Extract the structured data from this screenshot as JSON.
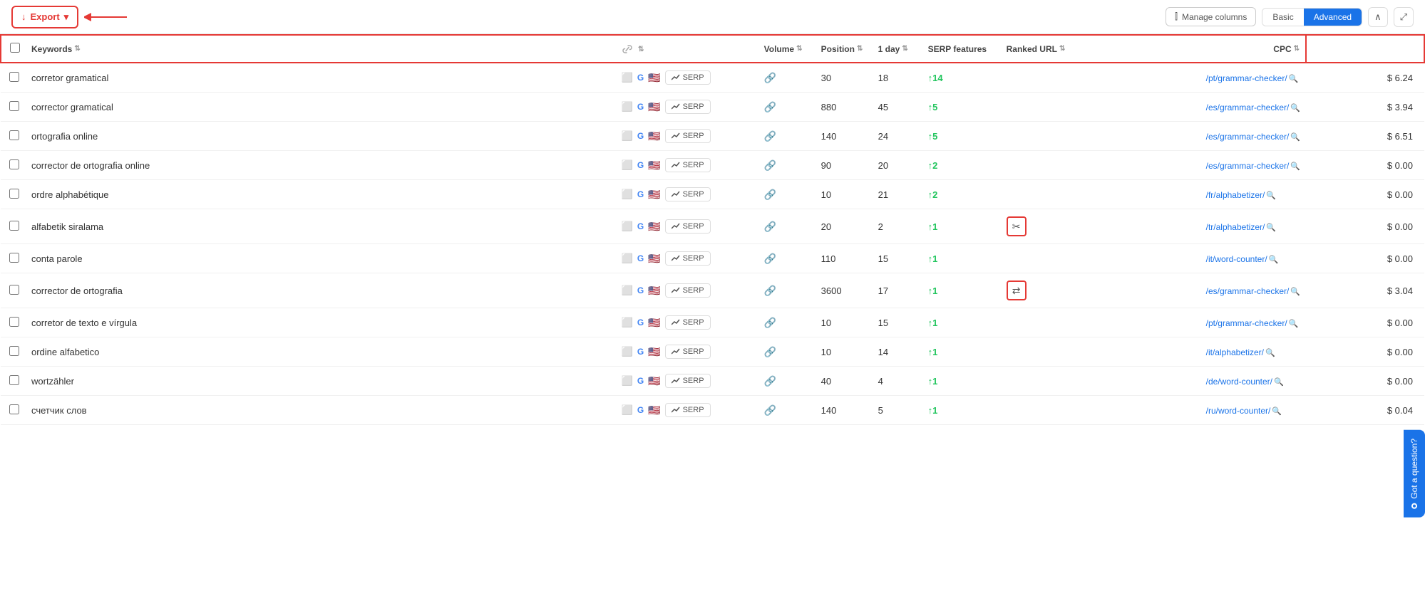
{
  "toolbar": {
    "export_label": "Export",
    "manage_columns_label": "Manage columns",
    "basic_label": "Basic",
    "advanced_label": "Advanced",
    "collapse_icon": "chevron-up",
    "expand_icon": "expand"
  },
  "table": {
    "columns": {
      "checkbox": "",
      "keywords": "Keywords",
      "volume": "Volume",
      "position": "Position",
      "one_day": "1 day",
      "serp_features": "SERP features",
      "ranked_url": "Ranked URL",
      "cpc": "CPC"
    },
    "rows": [
      {
        "keyword": "corretor gramatical",
        "volume": "30",
        "position": "18",
        "change": "+14",
        "change_dir": "up",
        "url": "/pt/grammar-checker/",
        "cpc": "$ 6.24",
        "serp_icon": ""
      },
      {
        "keyword": "corrector gramatical",
        "volume": "880",
        "position": "45",
        "change": "+5",
        "change_dir": "up",
        "url": "/es/grammar-checker/",
        "cpc": "$ 3.94",
        "serp_icon": ""
      },
      {
        "keyword": "ortografia online",
        "volume": "140",
        "position": "24",
        "change": "+5",
        "change_dir": "up",
        "url": "/es/grammar-checker/",
        "cpc": "$ 6.51",
        "serp_icon": ""
      },
      {
        "keyword": "corrector de ortografia online",
        "volume": "90",
        "position": "20",
        "change": "+2",
        "change_dir": "up",
        "url": "/es/grammar-checker/",
        "cpc": "$ 0.00",
        "serp_icon": ""
      },
      {
        "keyword": "ordre alphabétique",
        "volume": "10",
        "position": "21",
        "change": "+2",
        "change_dir": "up",
        "url": "/fr/alphabetizer/",
        "cpc": "$ 0.00",
        "serp_icon": ""
      },
      {
        "keyword": "alfabetik siralama",
        "volume": "20",
        "position": "2",
        "change": "+1",
        "change_dir": "up",
        "url": "/tr/alphabetizer/",
        "cpc": "$ 0.00",
        "serp_icon": "scissors"
      },
      {
        "keyword": "conta parole",
        "volume": "110",
        "position": "15",
        "change": "+1",
        "change_dir": "up",
        "url": "/it/word-counter/",
        "cpc": "$ 0.00",
        "serp_icon": ""
      },
      {
        "keyword": "corrector de ortografia",
        "volume": "3600",
        "position": "17",
        "change": "+1",
        "change_dir": "up",
        "url": "/es/grammar-checker/",
        "cpc": "$ 3.04",
        "serp_icon": "arrows"
      },
      {
        "keyword": "corretor de texto e vírgula",
        "volume": "10",
        "position": "15",
        "change": "+1",
        "change_dir": "up",
        "url": "/pt/grammar-checker/",
        "cpc": "$ 0.00",
        "serp_icon": ""
      },
      {
        "keyword": "ordine alfabetico",
        "volume": "10",
        "position": "14",
        "change": "+1",
        "change_dir": "up",
        "url": "/it/alphabetizer/",
        "cpc": "$ 0.00",
        "serp_icon": ""
      },
      {
        "keyword": "wortzähler",
        "volume": "40",
        "position": "4",
        "change": "+1",
        "change_dir": "up",
        "url": "/de/word-counter/",
        "cpc": "$ 0.00",
        "serp_icon": ""
      },
      {
        "keyword": "счетчик слов",
        "volume": "140",
        "position": "5",
        "change": "+1",
        "change_dir": "up",
        "url": "/ru/word-counter/",
        "cpc": "$ 0.04",
        "serp_icon": ""
      }
    ]
  },
  "chat": {
    "label": "Got a question?"
  }
}
